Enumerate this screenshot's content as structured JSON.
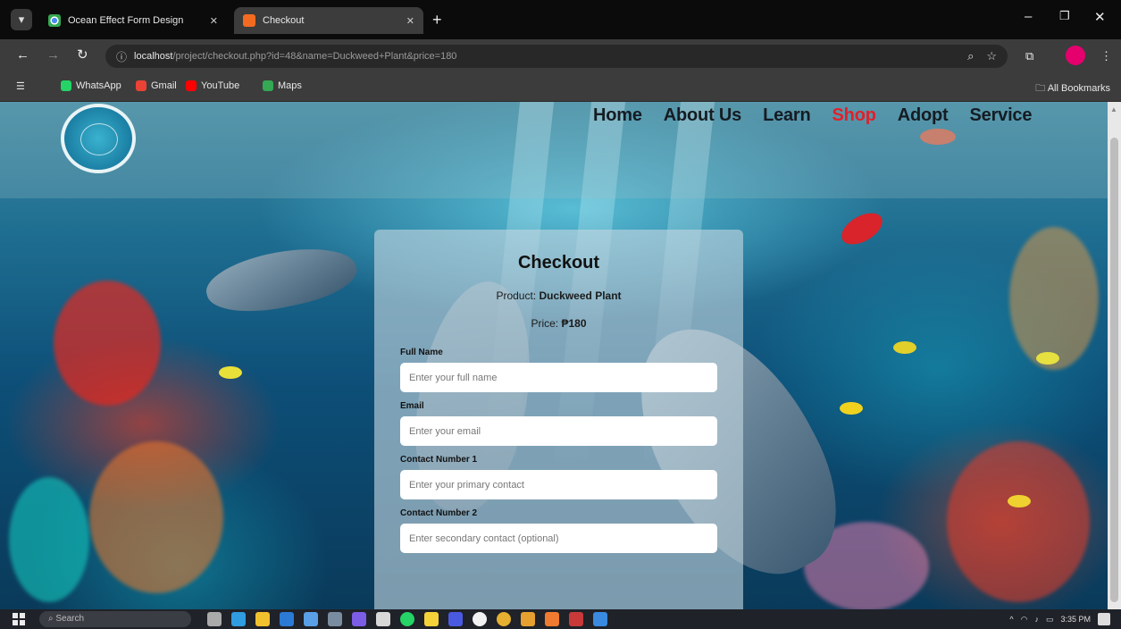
{
  "browser": {
    "menu_icon": "menu-icon",
    "tabs": [
      {
        "title": "Ocean Effect Form Design",
        "favicon": "chrome-icon",
        "active": false
      },
      {
        "title": "Checkout",
        "favicon": "orange-page-icon",
        "active": true
      }
    ],
    "address": {
      "host": "localhost",
      "path": "/project/checkout.php?id=48&name=Duckweed+Plant&price=180"
    },
    "bookmarks": [
      {
        "label": "WhatsApp",
        "color": "#25d366"
      },
      {
        "label": "Gmail",
        "color": "#ea4335"
      },
      {
        "label": "YouTube",
        "color": "#ff0000"
      },
      {
        "label": "Maps",
        "color": "#34a853"
      }
    ],
    "all_bookmarks": "All Bookmarks"
  },
  "site": {
    "nav": [
      {
        "label": "Home",
        "current": false
      },
      {
        "label": "About Us",
        "current": false
      },
      {
        "label": "Learn",
        "current": false
      },
      {
        "label": "Shop",
        "current": true
      },
      {
        "label": "Adopt",
        "current": false
      },
      {
        "label": "Service",
        "current": false
      }
    ],
    "accent_current": "#e0202a"
  },
  "checkout": {
    "title": "Checkout",
    "product_label": "Product:",
    "product_name": "Duckweed Plant",
    "price_label": "Price:",
    "price_value": "₱180",
    "fields": [
      {
        "label": "Full Name",
        "placeholder": "Enter your full name"
      },
      {
        "label": "Email",
        "placeholder": "Enter your email"
      },
      {
        "label": "Contact Number 1",
        "placeholder": "Enter your primary contact"
      },
      {
        "label": "Contact Number 2",
        "placeholder": "Enter secondary contact (optional)"
      }
    ]
  },
  "taskbar": {
    "search_placeholder": "Search",
    "time": "3:35 PM"
  }
}
